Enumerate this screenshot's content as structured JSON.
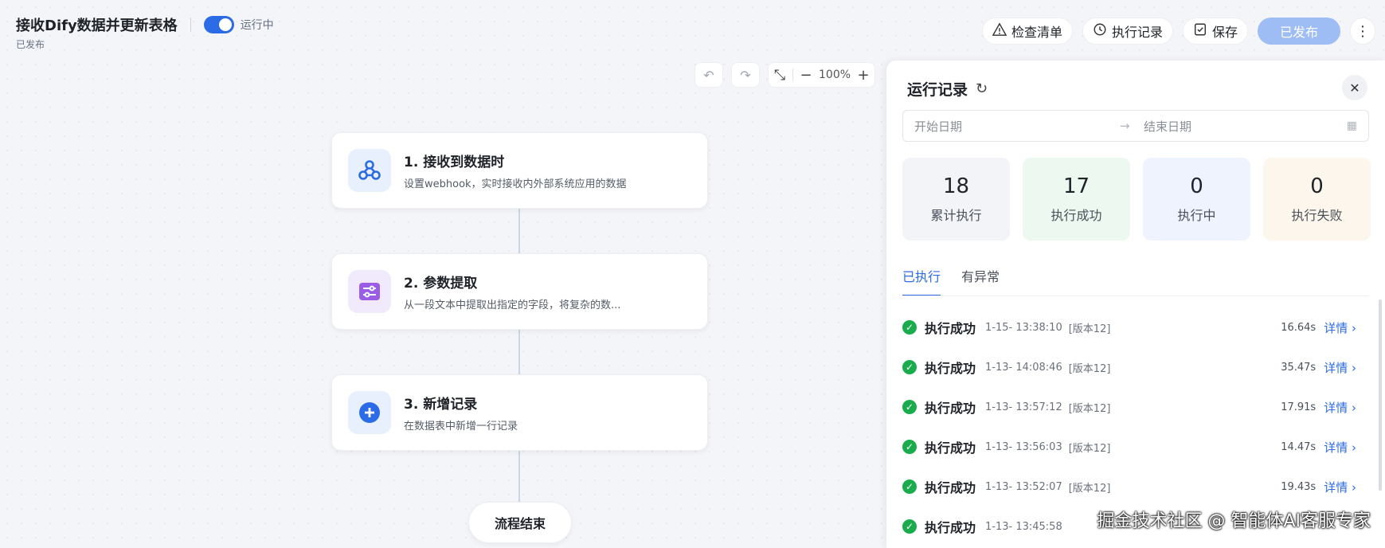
{
  "header": {
    "app_title": "接收Dify数据并更新表格",
    "run_status": "运行中",
    "publish_status": "已发布",
    "actions": {
      "checklist": "检查清单",
      "history": "执行记录",
      "save": "保存",
      "publish": "已发布",
      "more": "⋮"
    }
  },
  "canvas_toolbar": {
    "zoom": "100%"
  },
  "flow": {
    "nodes": [
      {
        "title": "1. 接收到数据时",
        "desc": "设置webhook，实时接收内外部系统应用的数据",
        "icon": "webhook-icon"
      },
      {
        "title": "2. 参数提取",
        "desc": "从一段文本中提取出指定的字段，将复杂的数...",
        "icon": "sliders-icon"
      },
      {
        "title": "3. 新增记录",
        "desc": "在数据表中新增一行记录",
        "icon": "plus-icon"
      }
    ],
    "end_label": "流程结束"
  },
  "panel": {
    "title": "运行记录",
    "date_start_placeholder": "开始日期",
    "date_end_placeholder": "结束日期",
    "stats": [
      {
        "value": "18",
        "label": "累计执行",
        "color": "#f2f4f7"
      },
      {
        "value": "17",
        "label": "执行成功",
        "color": "#edf8f1"
      },
      {
        "value": "0",
        "label": "执行中",
        "color": "#eef3fd"
      },
      {
        "value": "0",
        "label": "执行失败",
        "color": "#fdf6ec"
      }
    ],
    "tabs": [
      "已执行",
      "有异常"
    ],
    "records": [
      {
        "status": "执行成功",
        "time": "1-15- 13:38:10",
        "version": "[版本12]",
        "duration": "16.64s",
        "detail": "详情 ›"
      },
      {
        "status": "执行成功",
        "time": "1-13- 14:08:46",
        "version": "[版本12]",
        "duration": "35.47s",
        "detail": "详情 ›"
      },
      {
        "status": "执行成功",
        "time": "1-13- 13:57:12",
        "version": "[版本12]",
        "duration": "17.91s",
        "detail": "详情 ›"
      },
      {
        "status": "执行成功",
        "time": "1-13- 13:56:03",
        "version": "[版本12]",
        "duration": "14.47s",
        "detail": "详情 ›"
      },
      {
        "status": "执行成功",
        "time": "1-13- 13:52:07",
        "version": "[版本12]",
        "duration": "19.43s",
        "detail": "详情 ›"
      },
      {
        "status": "执行成功",
        "time": "1-13- 13:45:58",
        "version": "",
        "duration": "",
        "detail": ""
      }
    ]
  },
  "credit": "掘金技术社区 @ 智能体AI客服专家"
}
